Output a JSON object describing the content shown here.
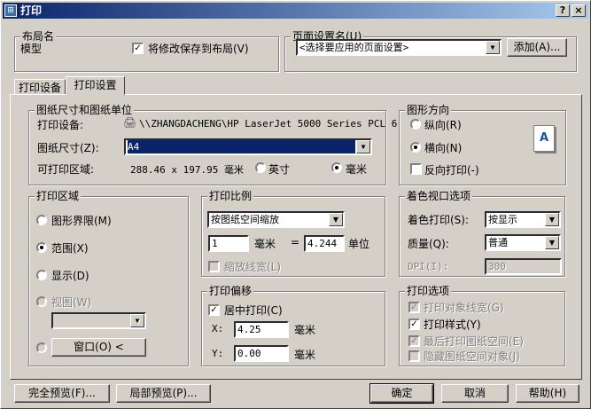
{
  "window": {
    "title": "打印",
    "help": "?",
    "close": "×",
    "icon": "app-icon"
  },
  "layout": {
    "label": "布局名",
    "name": "模型",
    "save_checkbox": "将修改保存到布局(V)",
    "save_checked": true
  },
  "page_setup": {
    "label": "页面设置名(U)",
    "value": "<选择要应用的页面设置>",
    "add_button": "添加(A)..."
  },
  "tabs": [
    {
      "label": "打印设备",
      "selected": false
    },
    {
      "label": "打印设置",
      "selected": true
    }
  ],
  "paper": {
    "label": "图纸尺寸和图纸单位",
    "device_label": "打印设备:",
    "device": "\\\\ZHANGDACHENG\\HP LaserJet 5000 Series PCL 6",
    "size_label": "图纸尺寸(Z):",
    "size": "A4",
    "area_label": "可打印区域:",
    "area": "288.46 x 197.95 毫米",
    "unit_inch": "英寸",
    "unit_mm": "毫米",
    "selected_unit": "毫米"
  },
  "orientation": {
    "label": "图形方向",
    "portrait": "纵向(R)",
    "landscape": "横向(N)",
    "reverse": "反向打印(-)",
    "selected": "横向(N)",
    "reverse_checked": false,
    "preview_letter": "A"
  },
  "area": {
    "label": "打印区域",
    "limits": "图形界限(M)",
    "extents": "范围(X)",
    "display": "显示(D)",
    "view": "视图(W)",
    "window_button": "窗口(O) <",
    "selected": "范围(X)"
  },
  "scale": {
    "label": "打印比例",
    "mode": "按图纸空间缩放",
    "mm_value": "1",
    "mm_label": "毫米",
    "equals": "=",
    "units_value": "4.244",
    "units_label": "单位",
    "lineweight": "缩放线宽(L)"
  },
  "offset": {
    "label": "打印偏移",
    "center": "居中打印(C)",
    "center_checked": true,
    "x_label": "X:",
    "x": "4.25",
    "y_label": "Y:",
    "y": "0.00",
    "x_unit": "毫米",
    "y_unit": "毫米"
  },
  "shade": {
    "label": "着色视口选项",
    "shade_label": "着色打印(S):",
    "shade": "按显示",
    "quality_label": "质量(Q):",
    "quality": "普通",
    "dpi_label": "DPI(I):",
    "dpi": "300"
  },
  "options": {
    "label": "打印选项",
    "items": [
      {
        "label": "打印对象线宽(G)",
        "checked": true,
        "enabled": false
      },
      {
        "label": "打印样式(Y)",
        "checked": true,
        "enabled": true
      },
      {
        "label": "最后打印图纸空间(E)",
        "checked": true,
        "enabled": false
      },
      {
        "label": "隐藏图纸空间对象(J)",
        "checked": false,
        "enabled": false
      }
    ]
  },
  "buttons": {
    "full_preview": "完全预览(F)...",
    "partial_preview": "局部预览(P)...",
    "ok": "确定",
    "cancel": "取消",
    "help": "帮助(H)"
  }
}
